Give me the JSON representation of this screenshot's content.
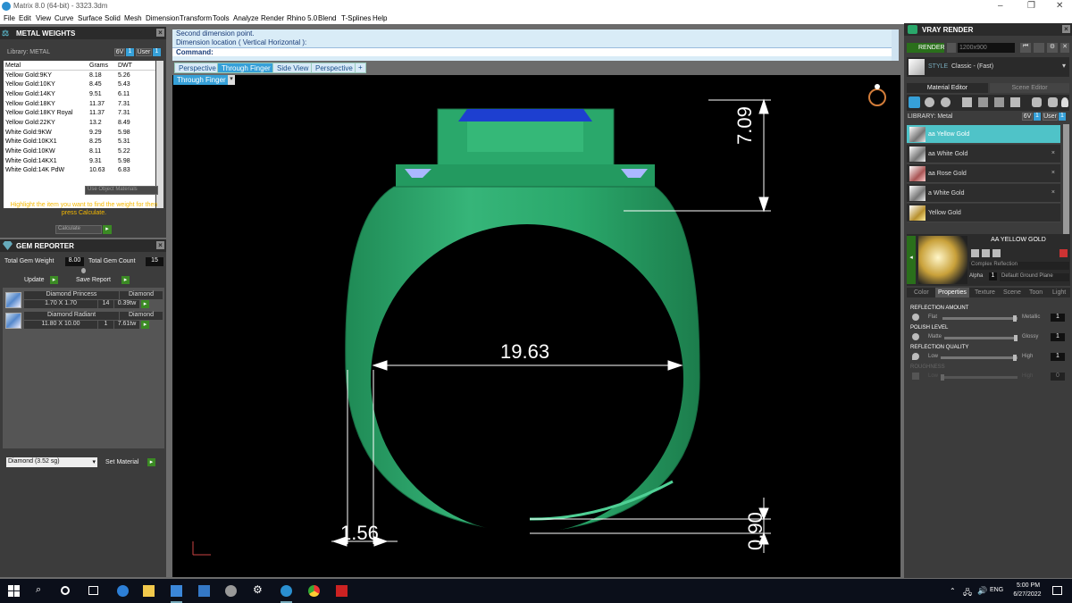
{
  "window": {
    "title": "Matrix 8.0 (64-bit) - 3323.3dm",
    "minimize": "–",
    "maximize": "❐",
    "close": "✕"
  },
  "menu": [
    "File",
    "Edit",
    "View",
    "Curve",
    "Surface",
    "Solid",
    "Mesh",
    "Dimension",
    "Transform",
    "Tools",
    "Analyze",
    "Render",
    "Rhino 5.0",
    "Blend",
    "T-Splines",
    "Help"
  ],
  "metal_weights": {
    "title": "METAL WEIGHTS",
    "library_label": "Library: METAL",
    "lib_buttons": [
      "6V",
      "1",
      "User",
      "1"
    ],
    "columns": [
      "Metal",
      "Grams",
      "DWT"
    ],
    "rows": [
      [
        "Yellow Gold:9KY",
        "8.18",
        "5.26"
      ],
      [
        "Yellow Gold:10KY",
        "8.45",
        "5.43"
      ],
      [
        "Yellow Gold:14KY",
        "9.51",
        "6.11"
      ],
      [
        "Yellow Gold:18KY",
        "11.37",
        "7.31"
      ],
      [
        "Yellow Gold:18KY Royal",
        "11.37",
        "7.31"
      ],
      [
        "Yellow Gold:22KY",
        "13.2",
        "8.49"
      ],
      [
        "White Gold:9KW",
        "9.29",
        "5.98"
      ],
      [
        "White Gold:10KX1",
        "8.25",
        "5.31"
      ],
      [
        "White Gold:10KW",
        "8.11",
        "5.22"
      ],
      [
        "White Gold:14KX1",
        "9.31",
        "5.98"
      ],
      [
        "White Gold:14K PdW",
        "10.63",
        "6.83"
      ]
    ],
    "use_object_materials": "Use Object Materials",
    "hint": "Highlight the item you want to find the weight for then press Calculate.",
    "calculate": "Calculate"
  },
  "gem_reporter": {
    "title": "GEM REPORTER",
    "total_weight_label": "Total Gem Weight",
    "total_weight": "8.00",
    "total_count_label": "Total Gem Count",
    "total_count": "15",
    "update": "Update",
    "save_report": "Save Report",
    "gems": [
      {
        "name": "Diamond Princess",
        "material": "Diamond",
        "size": "1.70 X 1.70",
        "count": "14",
        "weight": "0.39tw"
      },
      {
        "name": "Diamond Radiant",
        "material": "Diamond",
        "size": "11.80 X 10.00",
        "count": "1",
        "weight": "7.61tw"
      }
    ],
    "material_select": "Diamond      (3.52 sg)",
    "set_material": "Set Material"
  },
  "command": {
    "line1": "Second dimension point.",
    "line2": "Dimension location ( Vertical  Horizontal ):",
    "prompt": "Command:"
  },
  "view_tabs": [
    "Perspective",
    "Through Finger",
    "Side View",
    "Perspective"
  ],
  "view_tab_add": "+",
  "active_view_label": "Through Finger",
  "dimensions": {
    "width": "19.63",
    "top_height": "7.09",
    "shank": "1.56",
    "bottom": "0.90"
  },
  "vray": {
    "title": "VRAY RENDER",
    "render_label": "RENDER",
    "resolution": "1200x900",
    "style_label": "STYLE",
    "style_value": "Classic - (Fast)",
    "tabs": [
      "Material Editor",
      "Scene Editor"
    ],
    "library_label": "LIBRARY: Metal",
    "lib_buttons": [
      "6V",
      "1",
      "User",
      "1"
    ],
    "materials": [
      "aa Yellow Gold",
      "aa White Gold",
      "aa Rose Gold",
      "a White Gold",
      "Yellow Gold"
    ],
    "material_remove": "×",
    "preview_name": "AA YELLOW GOLD",
    "reflection_type": "Complex Reflection",
    "alpha_label": "Alpha",
    "alpha_value": "1",
    "ground_plane": "Default Ground Plane",
    "prop_tabs": [
      "Color",
      "Properties",
      "Texture",
      "Scene",
      "Toon",
      "Light"
    ],
    "props": [
      {
        "label": "REFLECTION AMOUNT",
        "low": "Flat",
        "high": "Metallic",
        "value": "1",
        "fill": 0.97
      },
      {
        "label": "POLISH LEVEL",
        "low": "Matte",
        "high": "Glossy",
        "value": "1",
        "fill": 0.97
      },
      {
        "label": "REFLECTION QUALITY",
        "low": "Low",
        "high": "High",
        "value": "1",
        "fill": 0.97
      },
      {
        "label": "ROUGHNESS",
        "low": "Low",
        "high": "High",
        "value": "0",
        "fill": 0.0
      }
    ]
  },
  "taskbar": {
    "time": "5:00 PM",
    "date": "6/27/2022",
    "lang": "ENG"
  },
  "colors": {
    "ring": "#2aa86b",
    "accent": "#3b8a24",
    "selection": "#4fc3c8",
    "gem": "#1d3fd0"
  }
}
